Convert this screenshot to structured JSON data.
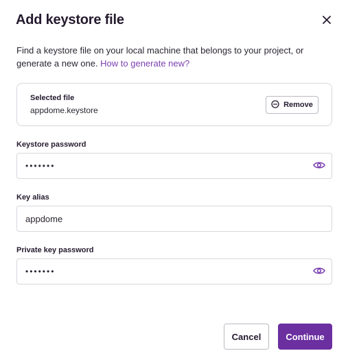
{
  "dialog": {
    "title": "Add keystore file",
    "description": "Find a keystore file on your local machine that belongs to your project, or generate a new one.",
    "help_link": "How to generate new?"
  },
  "selected_file": {
    "label": "Selected file",
    "name": "appdome.keystore",
    "remove_label": "Remove"
  },
  "fields": {
    "keystore_password": {
      "label": "Keystore password",
      "value": "•••••••"
    },
    "key_alias": {
      "label": "Key alias",
      "value": "appdome"
    },
    "private_key_password": {
      "label": "Private key password",
      "value": "•••••••"
    }
  },
  "buttons": {
    "cancel": "Cancel",
    "continue": "Continue"
  },
  "colors": {
    "accent": "#6b2fa0",
    "link": "#7b3fb0",
    "border": "#d9d6dc"
  },
  "icons": {
    "close": "close-icon",
    "remove": "minus-circle-icon",
    "reveal": "eye-icon"
  }
}
